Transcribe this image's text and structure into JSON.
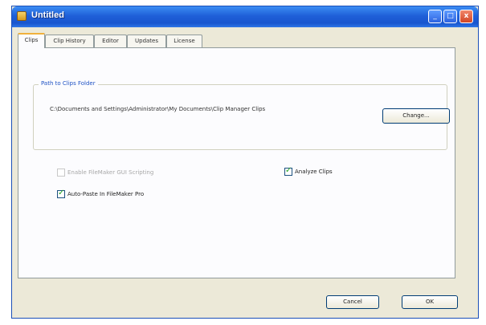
{
  "window": {
    "title": "Untitled"
  },
  "titlebar": {
    "minimize": "_",
    "maximize": "□",
    "close": "x"
  },
  "tabs": [
    {
      "label": "Clips",
      "active": true
    },
    {
      "label": "Clip History",
      "active": false
    },
    {
      "label": "Editor",
      "active": false
    },
    {
      "label": "Updates",
      "active": false
    },
    {
      "label": "License",
      "active": false
    }
  ],
  "clips_panel": {
    "group_title": "Path to Clips Folder",
    "path": "C:\\Documents and Settings\\Administrator\\My Documents\\Clip Manager Clips",
    "change_label": "Change...",
    "options": {
      "gui_scripting": {
        "label": "Enable FileMaker GUI Scripting",
        "checked": false,
        "disabled": true
      },
      "analyze_clips": {
        "label": "Analyze Clips",
        "checked": true,
        "disabled": false
      },
      "auto_paste": {
        "label": "Auto-Paste In FileMaker Pro",
        "checked": true,
        "disabled": false
      }
    }
  },
  "footer": {
    "cancel_label": "Cancel",
    "ok_label": "OK"
  },
  "colors": {
    "titlebar": "#1f5fd8",
    "group_title": "#1f52c4",
    "active_tab_accent": "#f1b13c",
    "window_face": "#ece9d8"
  }
}
